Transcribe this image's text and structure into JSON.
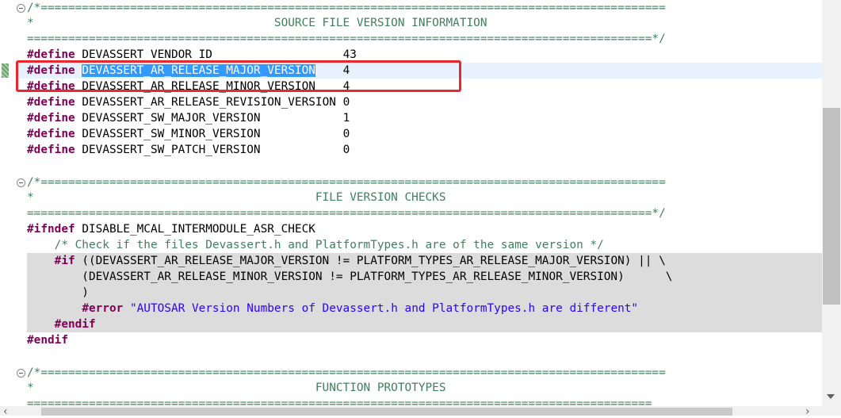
{
  "editor": {
    "source_block": {
      "open": "/*===========================================================================================",
      "title": "*                                   SOURCE FILE VERSION INFORMATION",
      "close": "===========================================================================================*/"
    },
    "defines": [
      {
        "kw": "#define",
        "name": "DEVASSERT_VENDOR_ID",
        "pad": "                   ",
        "value": "43"
      },
      {
        "kw": "#define",
        "name": "DEVASSERT_AR_RELEASE_MAJOR_VERSION",
        "pad": "    ",
        "value": "4"
      },
      {
        "kw": "#define",
        "name": "DEVASSERT_AR_RELEASE_MINOR_VERSION",
        "pad": "    ",
        "value": "4"
      },
      {
        "kw": "#define",
        "name": "DEVASSERT_AR_RELEASE_REVISION_VERSION",
        "pad": " ",
        "value": "0"
      },
      {
        "kw": "#define",
        "name": "DEVASSERT_SW_MAJOR_VERSION",
        "pad": "            ",
        "value": "1"
      },
      {
        "kw": "#define",
        "name": "DEVASSERT_SW_MINOR_VERSION",
        "pad": "            ",
        "value": "0"
      },
      {
        "kw": "#define",
        "name": "DEVASSERT_SW_PATCH_VERSION",
        "pad": "            ",
        "value": "0"
      }
    ],
    "checks_block": {
      "open": "/*===========================================================================================",
      "title": "*                                         FILE VERSION CHECKS",
      "close": "===========================================================================================*/"
    },
    "ifndef_kw": "#ifndef",
    "ifndef_name": " DISABLE_MCAL_INTERMODULE_ASR_CHECK",
    "check_comment": "    /* Check if the files Devassert.h and PlatformTypes.h are of the same version */",
    "if_kw": "#if",
    "if_line1": " ((DEVASSERT_AR_RELEASE_MAJOR_VERSION != PLATFORM_TYPES_AR_RELEASE_MAJOR_VERSION) || \\",
    "if_line2": "        (DEVASSERT_AR_RELEASE_MINOR_VERSION != PLATFORM_TYPES_AR_RELEASE_MINOR_VERSION)      \\",
    "if_line3": "        )",
    "error_kw": "#error",
    "error_str": "\"AUTOSAR Version Numbers of Devassert.h and PlatformTypes.h are different\"",
    "endif_inner": "#endif",
    "endif_outer": "#endif",
    "proto_block": {
      "open": "/*===========================================================================================",
      "title": "*                                         FUNCTION PROTOTYPES",
      "close": "==========================================================================================="
    }
  },
  "colors": {
    "keyword": "#7f0055",
    "comment": "#3f7f5f",
    "string": "#2a00ff",
    "selection": "#3399ff",
    "current_line": "#e8f2fe",
    "inactive_code": "#dcdcdc",
    "highlight_box": "#e8282d"
  },
  "icons": {
    "fold": "fold-toggle-icon",
    "marker": "occurrence-marker-icon",
    "scroll_down": "chevron-down-icon",
    "scroll_left": "chevron-left-icon",
    "scroll_right": "chevron-right-icon"
  },
  "scrollbar": {
    "left_arrow": "‹",
    "right_arrow": "›"
  }
}
